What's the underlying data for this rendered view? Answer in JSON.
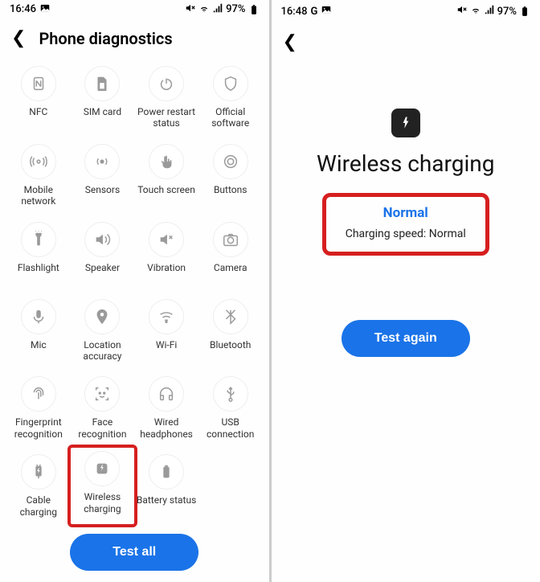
{
  "screens": [
    {
      "statusbar": {
        "time": "16:46",
        "icons_left": [
          "image"
        ],
        "battery_pct": "97%"
      },
      "header": {
        "title": "Phone diagnostics"
      },
      "items": [
        {
          "key": "nfc",
          "label": "NFC"
        },
        {
          "key": "sim",
          "label": "SIM card"
        },
        {
          "key": "power-restart",
          "label": "Power restart status"
        },
        {
          "key": "official-sw",
          "label": "Official software"
        },
        {
          "key": "mobile-net",
          "label": "Mobile network"
        },
        {
          "key": "sensors",
          "label": "Sensors"
        },
        {
          "key": "touch",
          "label": "Touch screen"
        },
        {
          "key": "buttons",
          "label": "Buttons"
        },
        {
          "key": "flashlight",
          "label": "Flashlight"
        },
        {
          "key": "speaker",
          "label": "Speaker"
        },
        {
          "key": "vibration",
          "label": "Vibration"
        },
        {
          "key": "camera",
          "label": "Camera"
        },
        {
          "key": "mic",
          "label": "Mic"
        },
        {
          "key": "location",
          "label": "Location accuracy"
        },
        {
          "key": "wifi",
          "label": "Wi-Fi"
        },
        {
          "key": "bluetooth",
          "label": "Bluetooth"
        },
        {
          "key": "fingerprint",
          "label": "Fingerprint recognition"
        },
        {
          "key": "face",
          "label": "Face recognition"
        },
        {
          "key": "headphones",
          "label": "Wired headphones"
        },
        {
          "key": "usb",
          "label": "USB connection"
        },
        {
          "key": "cable-chg",
          "label": "Cable charging"
        },
        {
          "key": "wireless-chg",
          "label": "Wireless charging",
          "highlighted": true
        },
        {
          "key": "battery",
          "label": "Battery status"
        }
      ],
      "cta": "Test all"
    },
    {
      "statusbar": {
        "time": "16:48",
        "icons_left": [
          "G",
          "image"
        ],
        "battery_pct": "97%"
      },
      "result": {
        "title": "Wireless charging",
        "status": "Normal",
        "detail": "Charging speed: Normal"
      },
      "cta": "Test again"
    }
  ]
}
